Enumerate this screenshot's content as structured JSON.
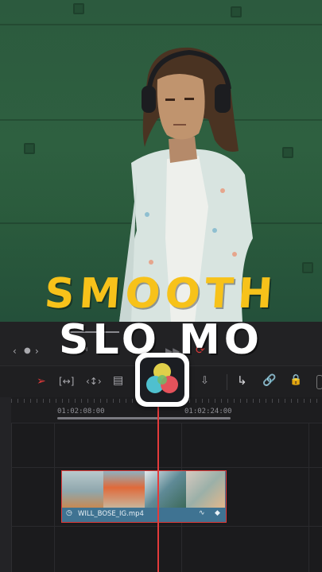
{
  "video": {
    "title_line1": "SMOOTH",
    "title_line2": "SLO MO",
    "title_line1_color": "#f7c21a",
    "title_line2_color": "#ffffff",
    "wall_color": "#2e6040"
  },
  "transport": {
    "nav_left_icon": "chevron-left-icon",
    "nav_dot_icon": "dot-icon",
    "nav_right_icon": "chevron-right-icon",
    "skip_back_icon": "skip-back-icon",
    "loop_icon": "loop-icon"
  },
  "toolbar": {
    "tools": [
      "selection-arrow-icon",
      "trim-icon",
      "dynamic-trim-icon",
      "blade-icon",
      "overwrite-icon",
      "snap-icon",
      "link-icon",
      "lock-icon"
    ]
  },
  "timeline": {
    "timecode_left": "01:02:08:00",
    "timecode_right": "01:02:24:00",
    "clip_name": "WILL_BOSE_IG.mp4",
    "playhead_color": "#e33b3b",
    "clip_color": "#3f7392"
  },
  "logo": {
    "name": "davinci-resolve-logo-icon"
  }
}
